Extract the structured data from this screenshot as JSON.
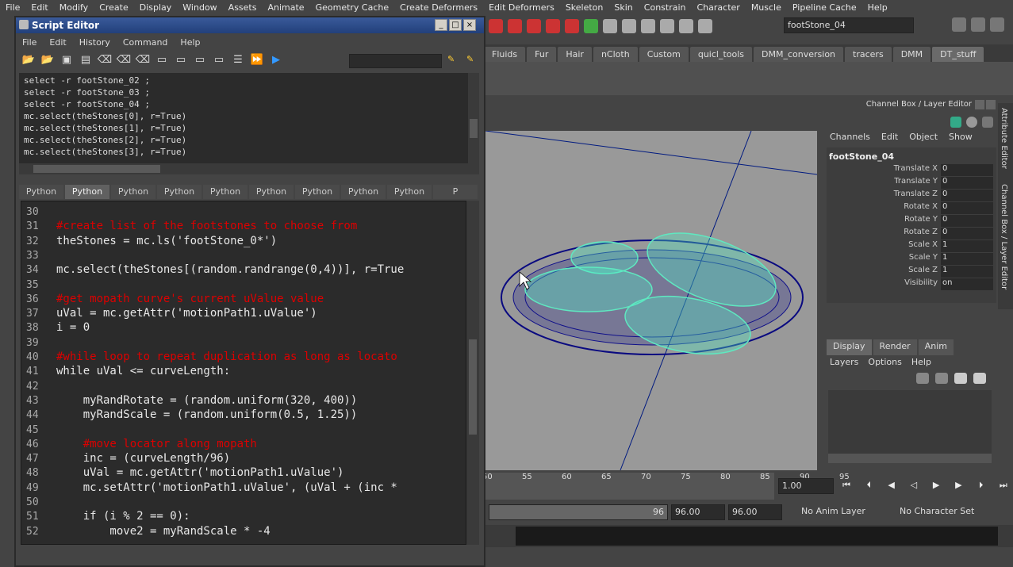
{
  "menubar": [
    "File",
    "Edit",
    "Modify",
    "Create",
    "Display",
    "Window",
    "Assets",
    "Animate",
    "Geometry Cache",
    "Create Deformers",
    "Edit Deformers",
    "Skeleton",
    "Skin",
    "Constrain",
    "Character",
    "Muscle",
    "Pipeline Cache",
    "Help"
  ],
  "object_field": "footStone_04",
  "shelf_tabs": [
    {
      "label": "Fluids"
    },
    {
      "label": "Fur"
    },
    {
      "label": "Hair"
    },
    {
      "label": "nCloth"
    },
    {
      "label": "Custom"
    },
    {
      "label": "quicl_tools"
    },
    {
      "label": "DMM_conversion"
    },
    {
      "label": "tracers"
    },
    {
      "label": "DMM"
    },
    {
      "label": "DT_stuff"
    }
  ],
  "channel_box": {
    "title": "Channel Box / Layer Editor",
    "menu": [
      "Channels",
      "Edit",
      "Object",
      "Show"
    ],
    "object": "footStone_04",
    "attrs": [
      {
        "name": "Translate X",
        "value": "0"
      },
      {
        "name": "Translate Y",
        "value": "0"
      },
      {
        "name": "Translate Z",
        "value": "0"
      },
      {
        "name": "Rotate X",
        "value": "0"
      },
      {
        "name": "Rotate Y",
        "value": "0"
      },
      {
        "name": "Rotate Z",
        "value": "0"
      },
      {
        "name": "Scale X",
        "value": "1"
      },
      {
        "name": "Scale Y",
        "value": "1"
      },
      {
        "name": "Scale Z",
        "value": "1"
      },
      {
        "name": "Visibility",
        "value": "on"
      }
    ],
    "side_tabs": [
      "Attribute Editor",
      "Channel Box / Layer Editor"
    ]
  },
  "layer_editor": {
    "tabs": [
      "Display",
      "Render",
      "Anim"
    ],
    "menu": [
      "Layers",
      "Options",
      "Help"
    ]
  },
  "timeline": {
    "ticks": [
      "50",
      "55",
      "60",
      "65",
      "70",
      "75",
      "80",
      "85",
      "90",
      "95"
    ],
    "current": "1.00",
    "end_field": "96",
    "range_a": "96.00",
    "range_b": "96.00",
    "anim_layer": "No Anim Layer",
    "char_set": "No Character Set"
  },
  "script_editor": {
    "title": "Script Editor",
    "menu": [
      "File",
      "Edit",
      "History",
      "Command",
      "Help"
    ],
    "history": [
      "select -r footStone_02 ;",
      "select -r footStone_03 ;",
      "select -r footStone_04 ;",
      "mc.select(theStones[0], r=True)",
      "mc.select(theStones[1], r=True)",
      "mc.select(theStones[2], r=True)",
      "mc.select(theStones[3], r=True)"
    ],
    "tabs": [
      "Python",
      "Python",
      "Python",
      "Python",
      "Python",
      "Python",
      "Python",
      "Python",
      "Python",
      "P"
    ],
    "code": [
      {
        "n": "30",
        "t": ""
      },
      {
        "n": "31",
        "t": "#create list of the footstones to choose from"
      },
      {
        "n": "32",
        "t": "theStones = mc.ls('footStone_0*')"
      },
      {
        "n": "33",
        "t": ""
      },
      {
        "n": "34",
        "t": "mc.select(theStones[(random.randrange(0,4))], r=True"
      },
      {
        "n": "35",
        "t": ""
      },
      {
        "n": "36",
        "t": "#get mopath curve's current uValue value"
      },
      {
        "n": "37",
        "t": "uVal = mc.getAttr('motionPath1.uValue')"
      },
      {
        "n": "38",
        "t": "i = 0"
      },
      {
        "n": "39",
        "t": ""
      },
      {
        "n": "40",
        "t": "#while loop to repeat duplication as long as locato"
      },
      {
        "n": "41",
        "t": "while uVal <= curveLength:"
      },
      {
        "n": "42",
        "t": ""
      },
      {
        "n": "43",
        "t": "    myRandRotate = (random.uniform(320, 400))"
      },
      {
        "n": "44",
        "t": "    myRandScale = (random.uniform(0.5, 1.25))"
      },
      {
        "n": "45",
        "t": ""
      },
      {
        "n": "46",
        "t": "    #move locator along mopath"
      },
      {
        "n": "47",
        "t": "    inc = (curveLength/96)"
      },
      {
        "n": "48",
        "t": "    uVal = mc.getAttr('motionPath1.uValue')"
      },
      {
        "n": "49",
        "t": "    mc.setAttr('motionPath1.uValue', (uVal + (inc *"
      },
      {
        "n": "50",
        "t": ""
      },
      {
        "n": "51",
        "t": "    if (i % 2 == 0):"
      },
      {
        "n": "52",
        "t": "        move2 = myRandScale * -4"
      }
    ]
  }
}
